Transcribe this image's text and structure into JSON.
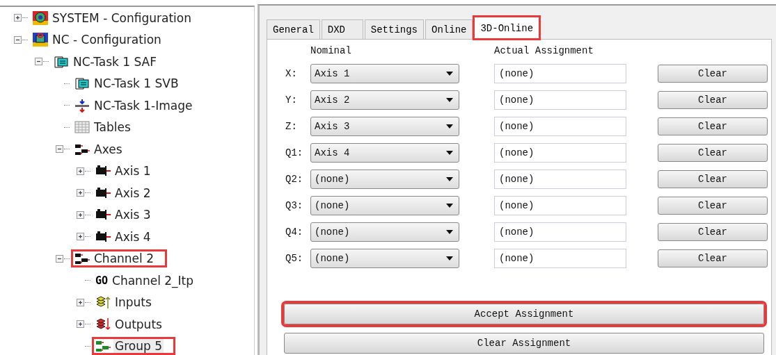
{
  "tree": [
    {
      "label": "SYSTEM - Configuration",
      "kind": "system",
      "expanded": false,
      "highlighted": false,
      "selected": false
    },
    {
      "label": "NC - Configuration",
      "kind": "nc",
      "expanded": true,
      "highlighted": false,
      "selected": false,
      "children": [
        {
          "label": "NC-Task 1 SAF",
          "kind": "task",
          "expanded": true,
          "highlighted": false,
          "selected": false,
          "children": [
            {
              "label": "NC-Task 1 SVB",
              "kind": "task",
              "highlighted": false,
              "selected": false
            },
            {
              "label": "NC-Task 1-Image",
              "kind": "image",
              "highlighted": false,
              "selected": false
            },
            {
              "label": "Tables",
              "kind": "table",
              "highlighted": false,
              "selected": false
            },
            {
              "label": "Axes",
              "kind": "axes",
              "expanded": true,
              "highlighted": false,
              "selected": false,
              "children": [
                {
                  "label": "Axis 1",
                  "kind": "axis",
                  "expanded": false,
                  "highlighted": false,
                  "selected": false
                },
                {
                  "label": "Axis 2",
                  "kind": "axis",
                  "expanded": false,
                  "highlighted": false,
                  "selected": false
                },
                {
                  "label": "Axis 3",
                  "kind": "axis",
                  "expanded": false,
                  "highlighted": false,
                  "selected": false
                },
                {
                  "label": "Axis 4",
                  "kind": "axis",
                  "expanded": false,
                  "highlighted": false,
                  "selected": false
                }
              ]
            },
            {
              "label": "Channel 2",
              "kind": "axes",
              "expanded": true,
              "highlighted": true,
              "selected": false,
              "children": [
                {
                  "label": "Channel 2_Itp",
                  "kind": "itp",
                  "badge": "GO",
                  "highlighted": false,
                  "selected": false
                },
                {
                  "label": "Inputs",
                  "kind": "inputs",
                  "expanded": false,
                  "highlighted": false,
                  "selected": false
                },
                {
                  "label": "Outputs",
                  "kind": "outputs",
                  "expanded": false,
                  "highlighted": false,
                  "selected": false
                },
                {
                  "label": "Group 5",
                  "kind": "group",
                  "highlighted": true,
                  "selected": true
                }
              ]
            }
          ]
        }
      ]
    }
  ],
  "tabs": [
    {
      "label": "General",
      "selected": false,
      "highlighted": false
    },
    {
      "label": "DXD",
      "selected": false,
      "highlighted": false
    },
    {
      "label": "Settings",
      "selected": false,
      "highlighted": false
    },
    {
      "label": "Online",
      "selected": false,
      "highlighted": false
    },
    {
      "label": "3D-Online",
      "selected": true,
      "highlighted": true
    }
  ],
  "columns": {
    "nominal": "Nominal",
    "actual": "Actual Assignment"
  },
  "axes": [
    {
      "label": "X:",
      "nominal": "Axis 1",
      "actual": "(none)",
      "button": "Clear"
    },
    {
      "label": "Y:",
      "nominal": "Axis 2",
      "actual": "(none)",
      "button": "Clear"
    },
    {
      "label": "Z:",
      "nominal": "Axis 3",
      "actual": "(none)",
      "button": "Clear"
    },
    {
      "label": "Q1:",
      "nominal": "Axis 4",
      "actual": "(none)",
      "button": "Clear"
    },
    {
      "label": "Q2:",
      "nominal": "(none)",
      "actual": "(none)",
      "button": "Clear"
    },
    {
      "label": "Q3:",
      "nominal": "(none)",
      "actual": "(none)",
      "button": "Clear"
    },
    {
      "label": "Q4:",
      "nominal": "(none)",
      "actual": "(none)",
      "button": "Clear"
    },
    {
      "label": "Q5:",
      "nominal": "(none)",
      "actual": "(none)",
      "button": "Clear"
    }
  ],
  "buttons": [
    {
      "label": "Accept Assignment",
      "highlighted": true
    },
    {
      "label": "Clear Assignment",
      "highlighted": false
    }
  ]
}
